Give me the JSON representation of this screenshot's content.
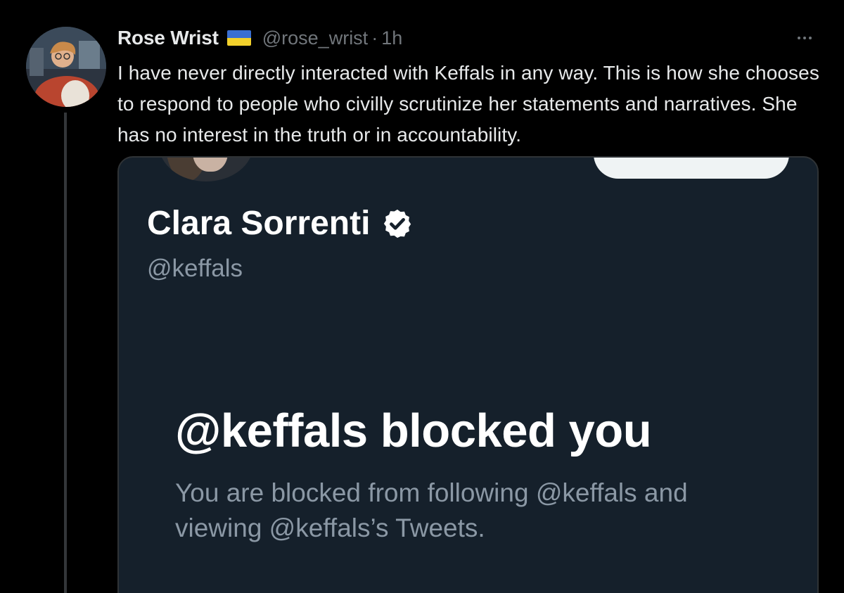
{
  "tweet": {
    "author": {
      "display_name": "Rose Wrist",
      "handle": "@rose_wrist",
      "separator": "·",
      "time": "1h",
      "avatar_icon": "profile-avatar",
      "flag_icon": "ukraine-flag-icon"
    },
    "more_icon": "more-options-icon",
    "text": "I have never directly interacted with Keffals in any way. This is how she chooses to respond to people who civilly scrutinize her statements and narratives. She has no interest in the truth or in accountability."
  },
  "media": {
    "profile_name": "Clara Sorrenti",
    "profile_handle": "@keffals",
    "verified_icon": "verified-badge-icon",
    "blocked_title": "@keffals blocked you",
    "blocked_description": "You are blocked from following @keffals and viewing @keffals’s Tweets."
  },
  "colors": {
    "background": "#000000",
    "text_primary": "#e7e9ea",
    "text_secondary": "#71767b",
    "media_background": "#15202b",
    "media_secondary_text": "#8b98a5",
    "flag_blue": "#3a6fd1",
    "flag_yellow": "#f2d02b"
  }
}
